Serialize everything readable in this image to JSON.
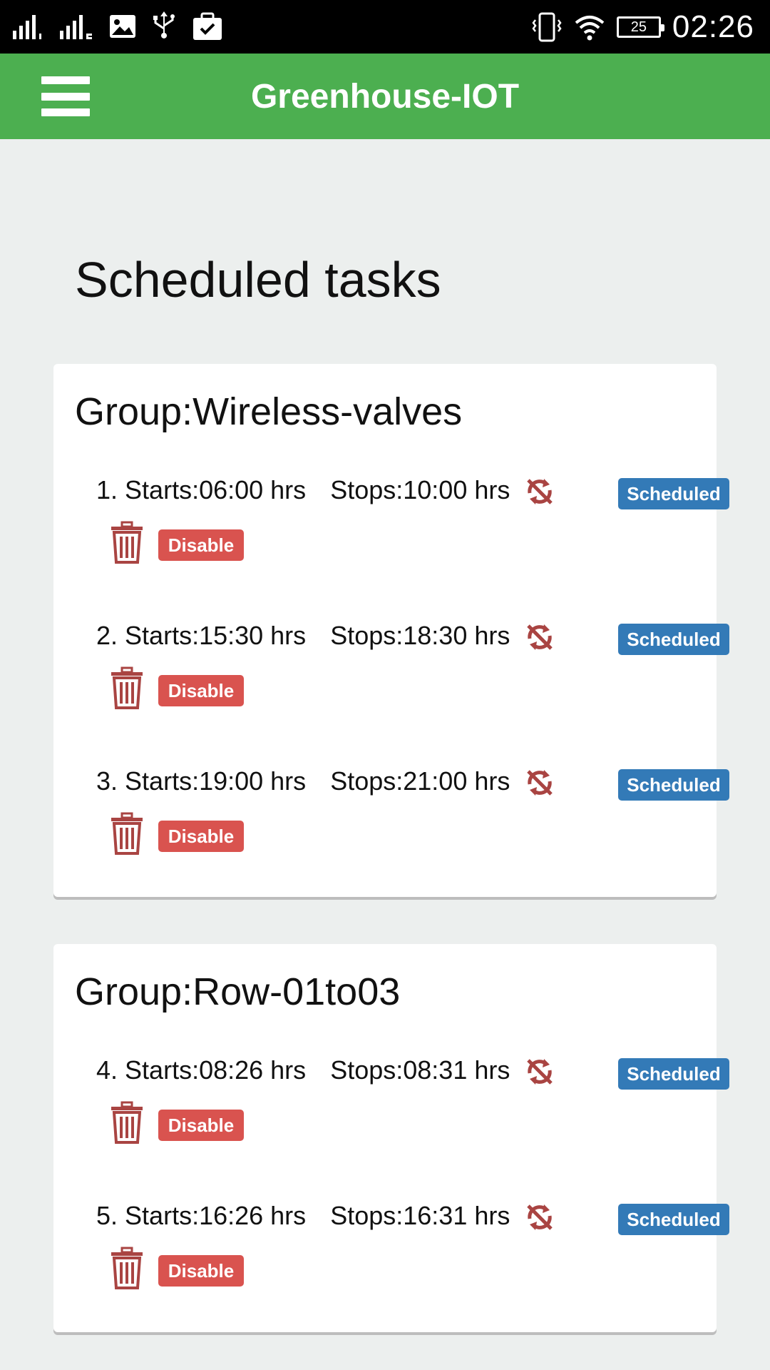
{
  "status_bar": {
    "time": "02:26",
    "battery_level": "25",
    "icons": [
      "signal-1-icon",
      "signal-2-icon",
      "image-icon",
      "usb-icon",
      "briefcase-check-icon",
      "vibrate-icon",
      "wifi-icon",
      "battery-icon"
    ]
  },
  "app_bar": {
    "title": "Greenhouse-IOT",
    "menu_icon": "hamburger-menu-icon",
    "color": "#4caf50"
  },
  "page": {
    "title": "Scheduled tasks"
  },
  "groups": [
    {
      "title": "Group:Wireless-valves",
      "tasks": [
        {
          "number": "1.",
          "starts": "Starts:06:00 hrs",
          "stops": "Stops:10:00 hrs",
          "status": "Scheduled",
          "action": "Disable"
        },
        {
          "number": "2.",
          "starts": "Starts:15:30 hrs",
          "stops": "Stops:18:30 hrs",
          "status": "Scheduled",
          "action": "Disable"
        },
        {
          "number": "3.",
          "starts": "Starts:19:00 hrs",
          "stops": "Stops:21:00 hrs",
          "status": "Scheduled",
          "action": "Disable"
        }
      ]
    },
    {
      "title": "Group:Row-01to03",
      "tasks": [
        {
          "number": "4.",
          "starts": "Starts:08:26 hrs",
          "stops": "Stops:08:31 hrs",
          "status": "Scheduled",
          "action": "Disable"
        },
        {
          "number": "5.",
          "starts": "Starts:16:26 hrs",
          "stops": "Stops:16:31 hrs",
          "status": "Scheduled",
          "action": "Disable"
        }
      ]
    }
  ],
  "colors": {
    "scheduled_badge": "#337ab7",
    "disable_button": "#d9534f",
    "icon_red": "#a94442",
    "background": "#ecefee"
  }
}
